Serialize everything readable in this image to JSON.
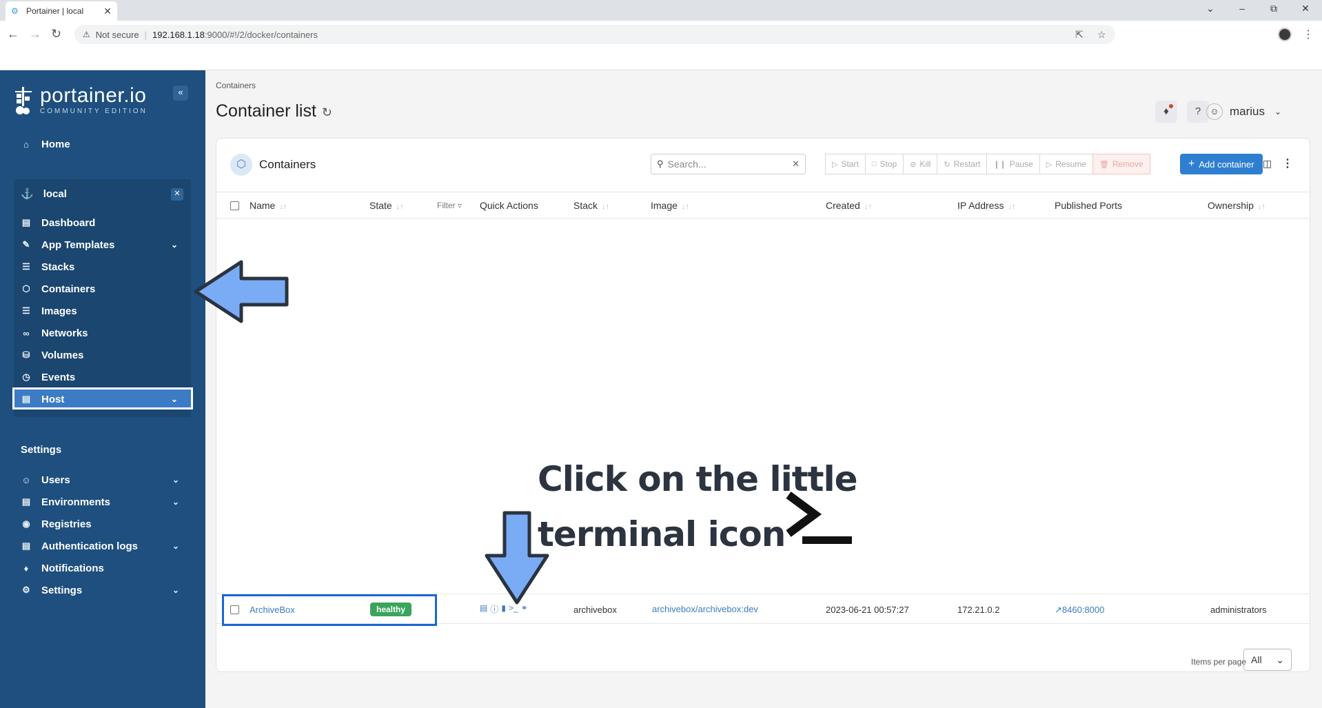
{
  "browser": {
    "tab_title": "Portainer | local",
    "security_label": "Not secure",
    "url_host": "192.168.1.18",
    "url_rest": ":9000/#!/2/docker/containers"
  },
  "sidebar": {
    "brand": "portainer.io",
    "brand_sub": "COMMUNITY EDITION",
    "home": "Home",
    "environment": {
      "name": "local",
      "items": [
        {
          "label": "Dashboard",
          "icon": "dashboard-icon"
        },
        {
          "label": "App Templates",
          "icon": "edit-icon"
        },
        {
          "label": "Stacks",
          "icon": "layers-icon"
        },
        {
          "label": "Containers",
          "icon": "box-icon"
        },
        {
          "label": "Images",
          "icon": "list-icon"
        },
        {
          "label": "Networks",
          "icon": "network-icon"
        },
        {
          "label": "Volumes",
          "icon": "database-icon"
        },
        {
          "label": "Events",
          "icon": "clock-icon"
        },
        {
          "label": "Host",
          "icon": "host-icon"
        }
      ]
    },
    "settings_title": "Settings",
    "settings_items": [
      {
        "label": "Users",
        "icon": "users-icon"
      },
      {
        "label": "Environments",
        "icon": "environments-icon"
      },
      {
        "label": "Registries",
        "icon": "radio-icon"
      },
      {
        "label": "Authentication logs",
        "icon": "file-icon"
      },
      {
        "label": "Notifications",
        "icon": "bell-icon"
      },
      {
        "label": "Settings",
        "icon": "gear-icon"
      }
    ]
  },
  "header": {
    "breadcrumb": "Containers",
    "title": "Container list",
    "username": "marius"
  },
  "panel": {
    "title": "Containers",
    "search_placeholder": "Search...",
    "actions": [
      "Start",
      "Stop",
      "Kill",
      "Restart",
      "Pause",
      "Resume",
      "Remove"
    ],
    "add_label": "Add container",
    "columns": {
      "name": "Name",
      "state": "State",
      "filter": "Filter",
      "quick_actions": "Quick Actions",
      "stack": "Stack",
      "image": "Image",
      "created": "Created",
      "ip": "IP Address",
      "ports": "Published Ports",
      "ownership": "Ownership"
    },
    "rows": [
      {
        "name": "ArchiveBox",
        "state": "healthy",
        "stack": "archivebox",
        "image": "archivebox/archivebox:dev",
        "created": "2023-06-21 00:57:27",
        "ip": "172.21.0.2",
        "ports": "8460:8000",
        "ownership": "administrators"
      }
    ],
    "items_per_page_label": "Items per page",
    "items_per_page_value": "All"
  },
  "annotation": {
    "line1": "Click on the little",
    "line2": "terminal icon"
  },
  "colors": {
    "sidebar": "#1e4f7e",
    "accent": "#2f7fd0",
    "healthy": "#3aa55b",
    "arrow": "#7aabf5"
  }
}
